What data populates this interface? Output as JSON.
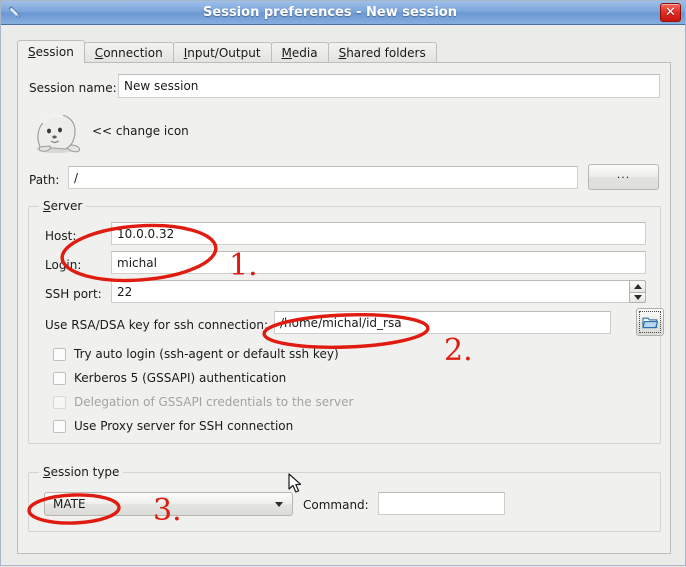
{
  "window": {
    "title": "Session preferences - New session",
    "title_icon": "pencil-icon",
    "close_label": "✕"
  },
  "tabs": [
    {
      "label": "Session",
      "mnemonic": "S",
      "active": true
    },
    {
      "label": "Connection",
      "mnemonic": "C",
      "active": false
    },
    {
      "label": "Input/Output",
      "mnemonic": "I",
      "active": false
    },
    {
      "label": "Media",
      "mnemonic": "M",
      "active": false
    },
    {
      "label": "Shared folders",
      "mnemonic": "S",
      "active": false
    }
  ],
  "session": {
    "name_label": "Session name:",
    "name_value": "New session",
    "change_icon_link": "<< change icon",
    "icon_name": "seal-mascot-icon",
    "path_label": "Path:",
    "path_value": "/",
    "path_browse_label": "..."
  },
  "server": {
    "group_title": "Server",
    "group_mnemonic": "S",
    "host_label": "Host:",
    "host_value": "10.0.0.32",
    "login_label": "Login:",
    "login_value": "michal",
    "ssh_port_label": "SSH port:",
    "ssh_port_value": "22",
    "key_label": "Use RSA/DSA key for ssh connection:",
    "key_value": "/home/michal/id_rsa",
    "key_browse_icon": "folder-open-icon",
    "checkboxes": [
      {
        "label": "Try auto login (ssh-agent or default ssh key)",
        "checked": false,
        "enabled": true
      },
      {
        "label": "Kerberos 5 (GSSAPI) authentication",
        "checked": false,
        "enabled": true
      },
      {
        "label": "Delegation of GSSAPI credentials to the server",
        "checked": false,
        "enabled": false
      },
      {
        "label": "Use Proxy server for SSH connection",
        "checked": false,
        "enabled": true
      }
    ]
  },
  "session_type": {
    "group_title": "Session type",
    "group_mnemonic": "S",
    "selected": "MATE",
    "command_label": "Command:",
    "command_value": ""
  },
  "annotations": {
    "marker_1": "1.",
    "marker_2": "2.",
    "marker_3": "3.",
    "ink_color": "#e01b10"
  }
}
